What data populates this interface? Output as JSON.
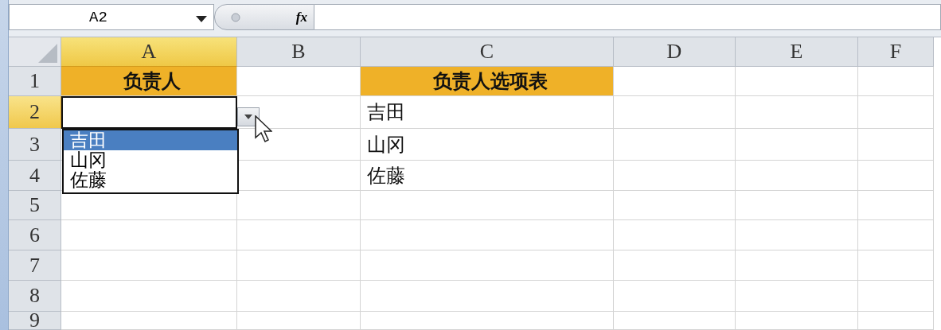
{
  "formula_bar": {
    "name_box": "A2",
    "function_label": "fx"
  },
  "columns": [
    {
      "label": "A",
      "selected": true
    },
    {
      "label": "B",
      "selected": false
    },
    {
      "label": "C",
      "selected": false
    },
    {
      "label": "D",
      "selected": false
    },
    {
      "label": "E",
      "selected": false
    },
    {
      "label": "F",
      "selected": false
    }
  ],
  "rows": [
    {
      "number": "1",
      "selected": false,
      "a": {
        "text": "负责人",
        "kind": "header"
      },
      "c": {
        "text": "负责人选项表",
        "kind": "header"
      }
    },
    {
      "number": "2",
      "selected": true,
      "a": {
        "active": true
      },
      "c": {
        "text": "吉田",
        "kind": "plain"
      }
    },
    {
      "number": "3",
      "selected": false,
      "c": {
        "text": "山冈",
        "kind": "plain"
      }
    },
    {
      "number": "4",
      "selected": false,
      "c": {
        "text": "佐藤",
        "kind": "plain"
      }
    },
    {
      "number": "5",
      "selected": false
    },
    {
      "number": "6",
      "selected": false
    },
    {
      "number": "7",
      "selected": false
    },
    {
      "number": "8",
      "selected": false
    },
    {
      "number": "9",
      "selected": false
    }
  ],
  "dropdown": {
    "items": [
      {
        "label": "吉田",
        "selected": true
      },
      {
        "label": "山冈",
        "selected": false
      },
      {
        "label": "佐藤",
        "selected": false
      }
    ]
  }
}
